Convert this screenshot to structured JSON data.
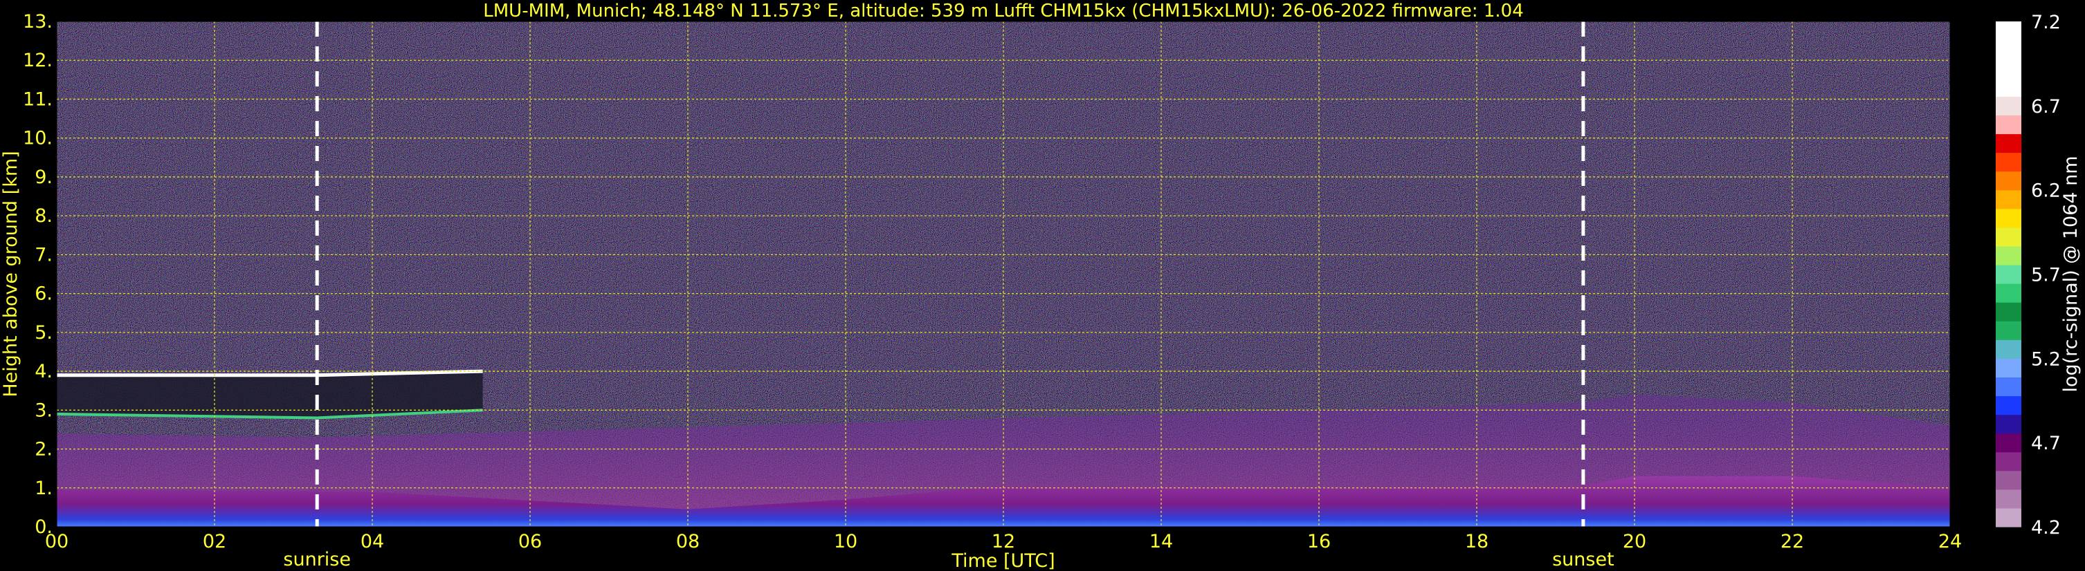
{
  "chart_data": {
    "type": "heatmap",
    "title": "LMU-MIM, Munich; 48.148° N 11.573° E, altitude: 539 m    Lufft CHM15kx (CHM15kxLMU): 26-06-2022    firmware: 1.04",
    "xlabel": "Time [UTC]",
    "ylabel": "Height above ground [km]",
    "xlim": [
      0,
      24
    ],
    "ylim": [
      0,
      13
    ],
    "x_ticks": [
      "00",
      "02",
      "04",
      "06",
      "08",
      "10",
      "12",
      "14",
      "16",
      "18",
      "20",
      "22",
      "24"
    ],
    "y_ticks": [
      "0.",
      "1.",
      "2.",
      "3.",
      "4.",
      "5.",
      "6.",
      "7.",
      "8.",
      "9.",
      "10.",
      "11.",
      "12.",
      "13."
    ],
    "grid": true,
    "markers": [
      {
        "name": "sunrise",
        "x": 3.3
      },
      {
        "name": "sunset",
        "x": 19.35
      }
    ],
    "colorbar": {
      "label": "log(rc-signal) @ 1064 nm",
      "range": [
        4.2,
        7.2
      ],
      "ticks": [
        "7.2",
        "6.7",
        "6.2",
        "5.7",
        "5.2",
        "4.7",
        "4.2"
      ],
      "colors": [
        "#c8a8c8",
        "#b080b0",
        "#9a5a9a",
        "#882a88",
        "#6a006a",
        "#2a12a0",
        "#1a3aff",
        "#4a78ff",
        "#7aa8ff",
        "#5ab8c8",
        "#20b060",
        "#109040",
        "#30c870",
        "#60e0a0",
        "#a8f060",
        "#e8f030",
        "#ffe000",
        "#ffb000",
        "#ff8000",
        "#ff4000",
        "#e00000",
        "#ffb0b0",
        "#f0e0e0",
        "#ffffff",
        "#ffffff",
        "#ffffff",
        "#ffffff"
      ]
    },
    "layers": [
      {
        "name": "boundary layer",
        "x": [
          0,
          4,
          8,
          10,
          12,
          16,
          19.35,
          20,
          22,
          24
        ],
        "top_km": [
          0.95,
          0.9,
          0.45,
          0.7,
          1.05,
          1.0,
          1.05,
          1.3,
          1.3,
          1.0
        ]
      },
      {
        "name": "residual aerosol layer",
        "x": [
          0,
          3.3,
          19.35,
          20,
          22,
          24
        ],
        "top_km": [
          2.4,
          2.3,
          3.2,
          3.4,
          3.2,
          2.6
        ]
      },
      {
        "name": "cloud layer",
        "x": [
          0,
          3.3,
          5.4
        ],
        "base_km": [
          2.9,
          2.8,
          3.0
        ],
        "top_km": [
          3.9,
          3.9,
          4.0
        ]
      }
    ]
  }
}
